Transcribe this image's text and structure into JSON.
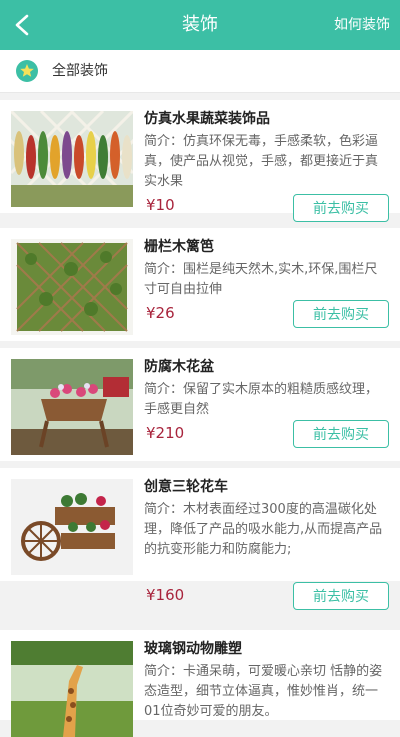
{
  "header": {
    "title": "装饰",
    "action_label": "如何装饰"
  },
  "category": {
    "label": "全部装饰"
  },
  "colors": {
    "accent": "#3cbfa5",
    "price": "#a8243c"
  },
  "products": [
    {
      "title": "仿真水果蔬菜装饰品",
      "description": "简介：仿真环保无毒，手感柔软，色彩逼真，使产品从视觉，手感，都更接近于真实水果",
      "price": "¥10",
      "button": "前去购买"
    },
    {
      "title": "栅栏木篱笆",
      "description": "简介：围栏是纯天然木,实木,环保,围栏尺寸可自由拉伸",
      "price": "¥26",
      "button": "前去购买"
    },
    {
      "title": "防腐木花盆",
      "description": "简介：保留了实木原本的粗糙质感纹理，手感更自然",
      "price": "¥210",
      "button": "前去购买"
    },
    {
      "title": "创意三轮花车",
      "description": "简介：木材表面经过300度的高温碳化处理，降低了产品的吸水能力,从而提高产品的抗变形能力和防腐能力;",
      "price": "¥160",
      "button": "前去购买"
    },
    {
      "title": "玻璃钢动物雕塑",
      "description": "简介：卡通呆萌，可爱暖心亲切 恬静的姿态造型，细节立体逼真，惟妙惟肖，统一01位奇妙可爱的朋友。",
      "price": "",
      "button": ""
    }
  ]
}
